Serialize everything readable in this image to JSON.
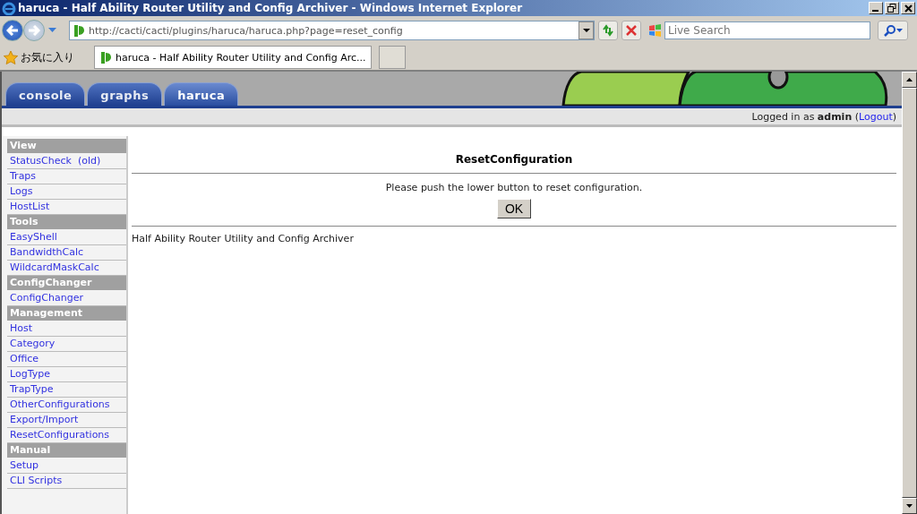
{
  "window": {
    "title": "haruca - Half Ability Router Utility and Config Archiver - Windows Internet Explorer"
  },
  "address_bar": {
    "url": "http://cacti/cacti/plugins/haruca/haruca.php?page=reset_config"
  },
  "search": {
    "placeholder": "Live Search"
  },
  "favorites": {
    "label": "お気に入り"
  },
  "browser_tabs": [
    {
      "label": "haruca - Half Ability Router Utility and Config Arc...",
      "selected": true
    }
  ],
  "app_tabs": [
    {
      "label": "console",
      "selected": false
    },
    {
      "label": "graphs",
      "selected": false
    },
    {
      "label": "haruca",
      "selected": true
    }
  ],
  "login": {
    "prefix": "Logged in as",
    "user": "admin",
    "open": "(",
    "link": "Logout",
    "close": ")"
  },
  "sidebar": [
    {
      "header": "View",
      "items": [
        "StatusCheck  (old)",
        "Traps",
        "Logs",
        "HostList"
      ]
    },
    {
      "header": "Tools",
      "items": [
        "EasyShell",
        "BandwidthCalc",
        "WildcardMaskCalc"
      ]
    },
    {
      "header": "ConfigChanger",
      "items": [
        "ConfigChanger"
      ]
    },
    {
      "header": "Management",
      "items": [
        "Host",
        "Category",
        "Office",
        "LogType",
        "TrapType",
        "OtherConfigurations",
        "Export/Import",
        "ResetConfigurations"
      ]
    },
    {
      "header": "Manual",
      "items": [
        "Setup",
        "CLI Scripts"
      ]
    }
  ],
  "content": {
    "title": "ResetConfiguration",
    "message": "Please push the lower button to reset configuration.",
    "button": "OK",
    "footer": "Half Ability Router Utility and Config Archiver"
  }
}
